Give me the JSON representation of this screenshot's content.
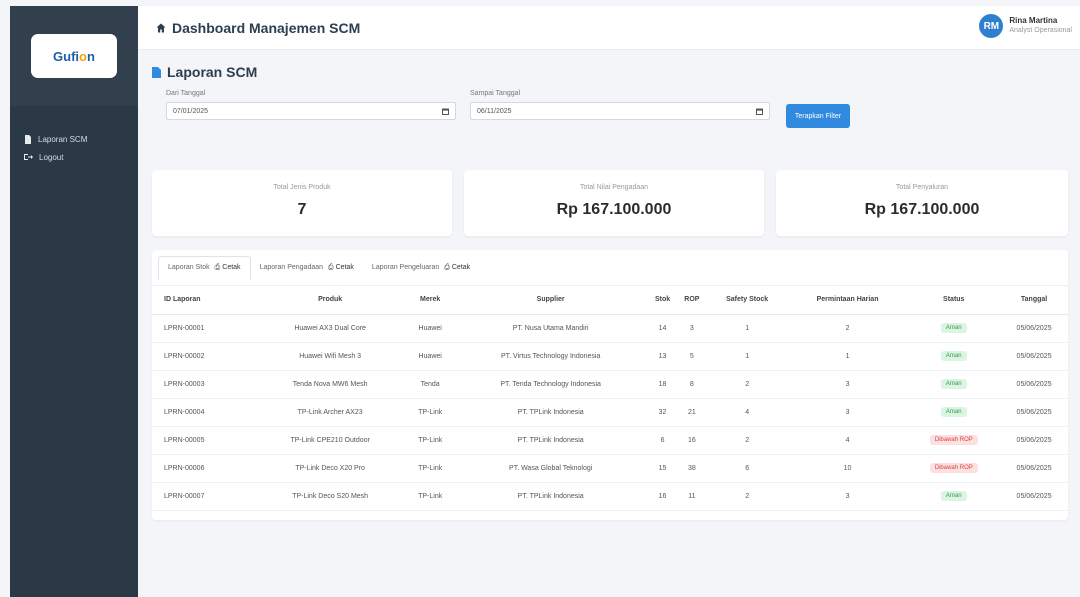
{
  "sidebar": {
    "logo": {
      "pre": "G",
      "brand": "ufi",
      "accent": "o",
      "post": "n"
    },
    "items": [
      {
        "label": "Laporan SCM",
        "icon": "document-icon"
      },
      {
        "label": "Logout",
        "icon": "logout-icon"
      }
    ]
  },
  "header": {
    "title": "Dashboard Manajemen SCM",
    "user": {
      "initials": "RM",
      "name": "Rina Martina",
      "role": "Analyst Operasional"
    }
  },
  "page": {
    "title": "Laporan SCM",
    "filter": {
      "from_label": "Dari Tanggal",
      "from_value": "07/01/2025",
      "to_label": "Sampai Tanggal",
      "to_value": "06/11/2025",
      "button_label": "Terapkan Filter"
    },
    "stats": [
      {
        "label": "Total Jenis Produk",
        "value": "7"
      },
      {
        "label": "Total Nilai Pengadaan",
        "value": "Rp 167.100.000"
      },
      {
        "label": "Total Penyaluran",
        "value": "Rp 167.100.000"
      }
    ],
    "tabs": [
      {
        "label": "Laporan Stok",
        "print": "Cetak"
      },
      {
        "label": "Laporan Pengadaan",
        "print": "Cetak"
      },
      {
        "label": "Laporan Pengeluaran",
        "print": "Cetak"
      }
    ],
    "table": {
      "headers": [
        "ID Laporan",
        "Produk",
        "Merek",
        "Supplier",
        "Stok",
        "ROP",
        "Safety Stock",
        "Permintaan Harian",
        "Status",
        "Tanggal"
      ],
      "rows": [
        [
          "LPRN-00001",
          "Huawei AX3 Dual Core",
          "Huawei",
          "PT. Nusa Utama Mandiri",
          "14",
          "3",
          "1",
          "2",
          "Aman",
          "05/06/2025"
        ],
        [
          "LPRN-00002",
          "Huawei Wifi Mesh 3",
          "Huawei",
          "PT. Virtus Technology Indonesia",
          "13",
          "5",
          "1",
          "1",
          "Aman",
          "05/06/2025"
        ],
        [
          "LPRN-00003",
          "Tenda Nova MW6 Mesh",
          "Tenda",
          "PT. Tenda Technology Indonesia",
          "18",
          "8",
          "2",
          "3",
          "Aman",
          "05/06/2025"
        ],
        [
          "LPRN-00004",
          "TP-Link Archer AX23",
          "TP-Link",
          "PT. TPLink Indonesia",
          "32",
          "21",
          "4",
          "3",
          "Aman",
          "05/06/2025"
        ],
        [
          "LPRN-00005",
          "TP-Link CPE210 Outdoor",
          "TP-Link",
          "PT. TPLink Indonesia",
          "6",
          "16",
          "2",
          "4",
          "Dibawah ROP",
          "05/06/2025"
        ],
        [
          "LPRN-00006",
          "TP-Link Deco X20 Pro",
          "TP-Link",
          "PT. Wasa Global Teknologi",
          "15",
          "38",
          "6",
          "10",
          "Dibawah ROP",
          "05/06/2025"
        ],
        [
          "LPRN-00007",
          "TP-Link Deco S20 Mesh",
          "TP-Link",
          "PT. TPLink Indonesia",
          "16",
          "11",
          "2",
          "3",
          "Aman",
          "05/06/2025"
        ]
      ]
    }
  }
}
